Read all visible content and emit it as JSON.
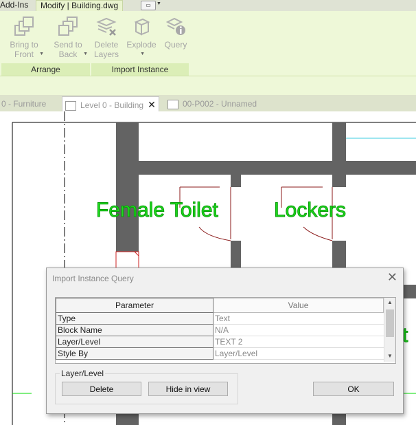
{
  "ribbon_tabs": {
    "addins": "Add-Ins",
    "modify": "Modify | Building.dwg"
  },
  "ribbon": {
    "buttons": [
      {
        "label": "Bring to\nFront",
        "icon": "bring-to-front-icon"
      },
      {
        "label": "Send to\nBack",
        "icon": "send-to-back-icon"
      },
      {
        "label": "Delete\nLayers",
        "icon": "delete-layers-icon"
      },
      {
        "label": "Explode",
        "icon": "explode-icon"
      },
      {
        "label": "Query",
        "icon": "query-icon"
      }
    ],
    "groups": {
      "arrange": "Arrange",
      "import_instance": "Import Instance"
    }
  },
  "view_tabs": {
    "furniture": "0 - Furniture",
    "building": "Level 0 - Building",
    "close": "✕",
    "unnamed": "00-P002 - Unnamed"
  },
  "drawing": {
    "labels": {
      "female_toilet": "Female Toilet",
      "lockers": "Lockers",
      "partial": "t"
    },
    "colors": {
      "wall": "#636363",
      "label": "#1cdc1c",
      "door": "#8b1a1a",
      "line_green": "#00dd00",
      "line_cyan": "#3ccde0"
    }
  },
  "dialog": {
    "title": "Import Instance Query",
    "close": "✕",
    "columns": [
      "Parameter",
      "Value"
    ],
    "rows": [
      {
        "parameter": "Type",
        "value": "Text"
      },
      {
        "parameter": "Block Name",
        "value": "N/A"
      },
      {
        "parameter": "Layer/Level",
        "value": "TEXT 2"
      },
      {
        "parameter": "Style By",
        "value": "Layer/Level"
      }
    ],
    "group_label": "Layer/Level",
    "buttons": {
      "delete": "Delete",
      "hide": "Hide in view",
      "ok": "OK"
    }
  }
}
